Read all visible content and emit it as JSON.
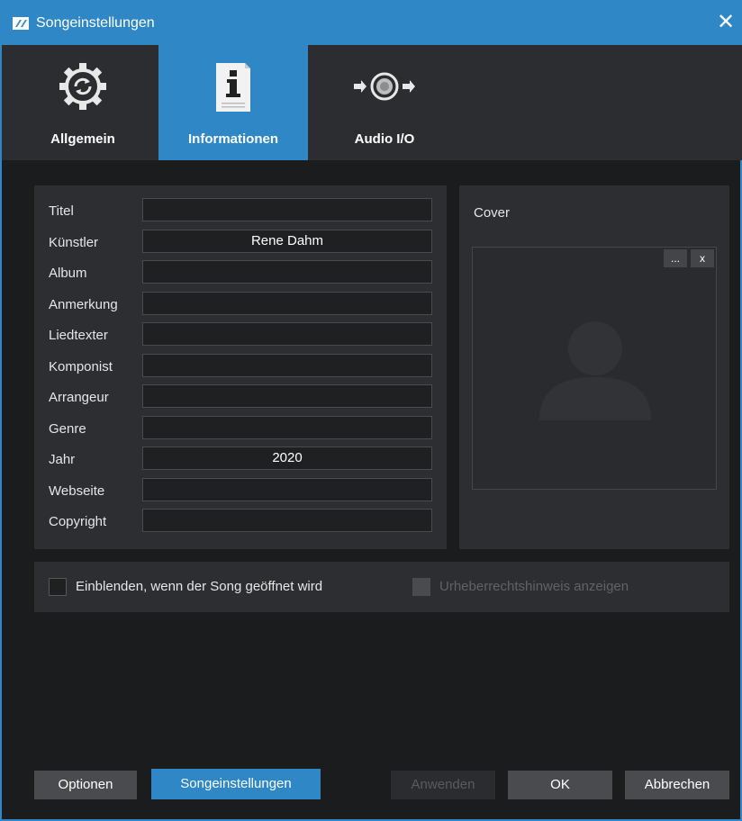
{
  "window": {
    "title": "Songeinstellungen",
    "close_label": "✕"
  },
  "tabs": [
    {
      "label": "Allgemein",
      "icon": "gear-sync-icon",
      "active": false
    },
    {
      "label": "Informationen",
      "icon": "info-document-icon",
      "active": true
    },
    {
      "label": "Audio I/O",
      "icon": "audio-io-icon",
      "active": false
    }
  ],
  "form": {
    "fields": [
      {
        "label": "Titel",
        "value": ""
      },
      {
        "label": "Künstler",
        "value": "Rene Dahm"
      },
      {
        "label": "Album",
        "value": ""
      },
      {
        "label": "Anmerkung",
        "value": ""
      },
      {
        "label": "Liedtexter",
        "value": ""
      },
      {
        "label": "Komponist",
        "value": ""
      },
      {
        "label": "Arrangeur",
        "value": ""
      },
      {
        "label": "Genre",
        "value": ""
      },
      {
        "label": "Jahr",
        "value": "2020"
      },
      {
        "label": "Webseite",
        "value": ""
      },
      {
        "label": "Copyright",
        "value": ""
      }
    ]
  },
  "cover": {
    "title": "Cover",
    "browse_label": "...",
    "remove_label": "x"
  },
  "options": {
    "show_on_open": {
      "label": "Einblenden, wenn der Song geöffnet wird",
      "checked": false
    },
    "show_copyright": {
      "label": "Urheberrechtshinweis anzeigen",
      "checked": false,
      "enabled": false
    }
  },
  "footer": {
    "options_label": "Optionen",
    "songsettings_label": "Songeinstellungen",
    "apply_label": "Anwenden",
    "ok_label": "OK",
    "cancel_label": "Abbrechen"
  },
  "colors": {
    "accent": "#2f87c6",
    "panel": "#2d2e31",
    "background": "#1b1c1e"
  }
}
